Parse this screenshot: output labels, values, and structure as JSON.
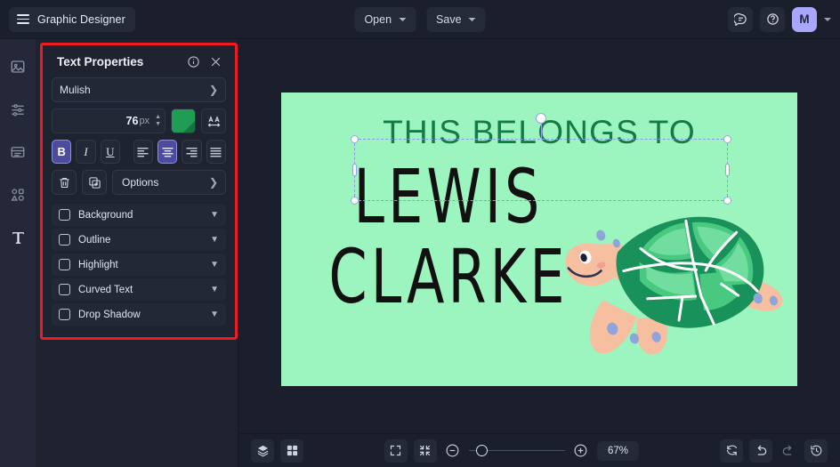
{
  "topbar": {
    "menu_icon": "hamburger-icon",
    "brand": "Graphic Designer",
    "open_label": "Open",
    "save_label": "Save",
    "comment_icon": "comment-icon",
    "help_icon": "help-circle-icon",
    "avatar_initial": "M"
  },
  "rail": {
    "items": [
      {
        "icon": "image-icon",
        "name": "image"
      },
      {
        "icon": "sliders-icon",
        "name": "adjustments"
      },
      {
        "icon": "layers-panel-icon",
        "name": "pages"
      },
      {
        "icon": "shapes-icon",
        "name": "elements"
      },
      {
        "icon": "text-icon",
        "name": "text"
      }
    ]
  },
  "panel": {
    "title": "Text Properties",
    "info_icon": "info-icon",
    "close_icon": "close-icon",
    "font": {
      "name": "Mulish",
      "chevron": "chevron-right-icon"
    },
    "font_size": {
      "value": "76",
      "unit": "px"
    },
    "color_swatch": "#1f9d55",
    "letter_spacing_icon": "letter-spacing-icon",
    "format": {
      "bold": "B",
      "bold_active": true,
      "italic": "I",
      "italic_active": false,
      "underline": "U",
      "underline_active": false,
      "align_left_active": false,
      "align_center_active": true,
      "align_right_active": false,
      "align_justify_active": false
    },
    "delete_icon": "trash-icon",
    "duplicate_icon": "duplicate-icon",
    "options_label": "Options",
    "options_chevron": "chevron-right-icon",
    "toggles": [
      {
        "label": "Background",
        "checked": false
      },
      {
        "label": "Outline",
        "checked": false
      },
      {
        "label": "Highlight",
        "checked": false
      },
      {
        "label": "Curved Text",
        "checked": false
      },
      {
        "label": "Drop Shadow",
        "checked": false
      }
    ],
    "highlight_border_color": "#ee1c22"
  },
  "canvas": {
    "background_color": "#9cf5bf",
    "heading_text": "THIS BELONGS TO",
    "heading_color": "#157a45",
    "name_line1": "LEWIS",
    "name_line2": "CLARKE",
    "name_color": "#111111",
    "illustration": "turtle-illustration",
    "selection_color": "#8e97e8"
  },
  "bottombar": {
    "layers_icon": "layers-icon",
    "grid_icon": "grid-icon",
    "fit_icon": "fit-screen-icon",
    "collapse_icon": "collapse-icon",
    "zoom_out_icon": "zoom-out-icon",
    "zoom_in_icon": "zoom-in-icon",
    "zoom_level": "67%",
    "reset_icon": "reset-icon",
    "undo_icon": "undo-icon",
    "redo_icon": "redo-icon",
    "history_icon": "history-icon"
  }
}
